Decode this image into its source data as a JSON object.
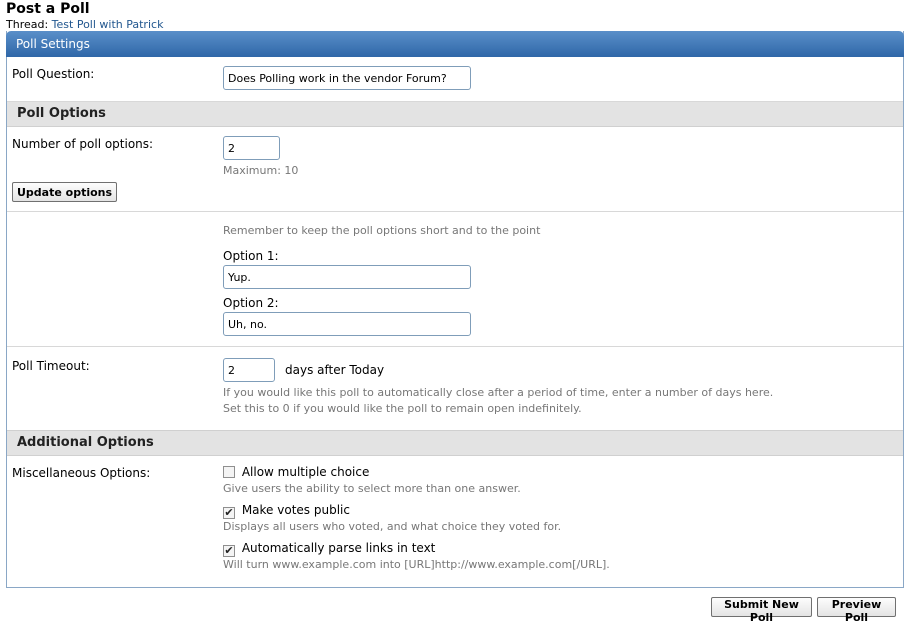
{
  "page": {
    "title": "Post a Poll",
    "thread_prefix": "Thread:",
    "thread_link": "Test Poll with Patrick"
  },
  "panel": {
    "header": "Poll Settings"
  },
  "question": {
    "label": "Poll Question:",
    "value": "Does Polling work in the vendor Forum?"
  },
  "poll_options": {
    "heading": "Poll Options",
    "count_label": "Number of poll options:",
    "count_value": "2",
    "max_hint": "Maximum: 10",
    "update_button": "Update options",
    "reminder": "Remember to keep the poll options short and to the point",
    "options": [
      {
        "label": "Option 1:",
        "value": "Yup."
      },
      {
        "label": "Option 2:",
        "value": "Uh, no."
      }
    ]
  },
  "timeout": {
    "label": "Poll Timeout:",
    "value": "2",
    "suffix": "days after Today",
    "hint1": "If you would like this poll to automatically close after a period of time, enter a number of days here.",
    "hint2": "Set this to 0 if you would like the poll to remain open indefinitely."
  },
  "additional": {
    "heading": "Additional Options",
    "label": "Miscellaneous Options:",
    "items": [
      {
        "label": "Allow multiple choice",
        "hint": "Give users the ability to select more than one answer.",
        "checked": false
      },
      {
        "label": "Make votes public",
        "hint": "Displays all users who voted, and what choice they voted for.",
        "checked": true
      },
      {
        "label": "Automatically parse links in text",
        "hint": "Will turn www.example.com into [URL]http://www.example.com[/URL].",
        "checked": true
      }
    ]
  },
  "actions": {
    "submit": "Submit New Poll",
    "preview": "Preview Poll"
  }
}
